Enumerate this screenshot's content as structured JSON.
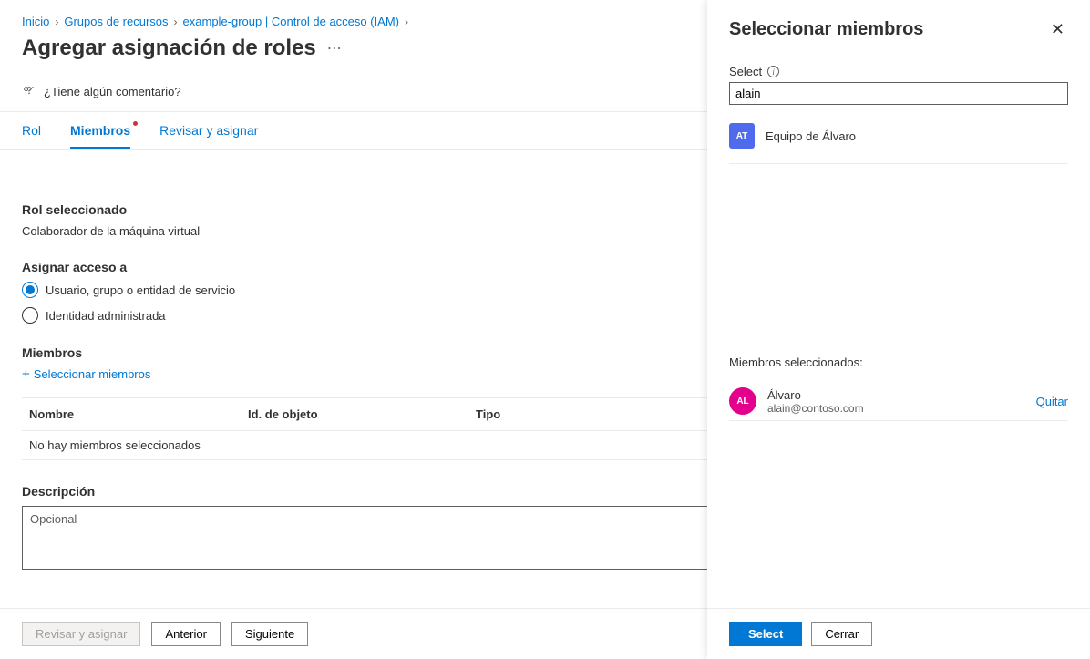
{
  "breadcrumb": {
    "items": [
      "Inicio",
      "Grupos de recursos",
      "example-group | Control de acceso (IAM)"
    ]
  },
  "page": {
    "title": "Agregar asignación de roles",
    "feedback_prompt": "¿Tiene algún comentario?"
  },
  "tabs": {
    "role": "Rol",
    "members": "Miembros",
    "review": "Revisar y asignar"
  },
  "content": {
    "selected_role_label": "Rol seleccionado",
    "selected_role_value": "Colaborador de la máquina virtual",
    "assign_access_label": "Asignar acceso a",
    "radio_user": "Usuario, grupo o entidad de servicio",
    "radio_managed": "Identidad administrada",
    "members_label": "Miembros",
    "select_members_link": "Seleccionar miembros",
    "table": {
      "col_name": "Nombre",
      "col_id": "Id. de objeto",
      "col_type": "Tipo",
      "empty": "No hay miembros seleccionados"
    },
    "description_label": "Descripción",
    "description_placeholder": "Opcional"
  },
  "footer": {
    "review": "Revisar y asignar",
    "previous": "Anterior",
    "next": "Siguiente"
  },
  "panel": {
    "title": "Seleccionar miembros",
    "select_label": "Select",
    "search_value": "alain",
    "results": [
      {
        "initials": "AT",
        "name": "Equipo de Álvaro"
      }
    ],
    "selected_label": "Miembros seleccionados:",
    "selected": [
      {
        "initials": "AL",
        "name": "Álvaro",
        "email": "alain@contoso.com"
      }
    ],
    "remove_label": "Quitar",
    "select_button": "Select",
    "close_button": "Cerrar"
  }
}
